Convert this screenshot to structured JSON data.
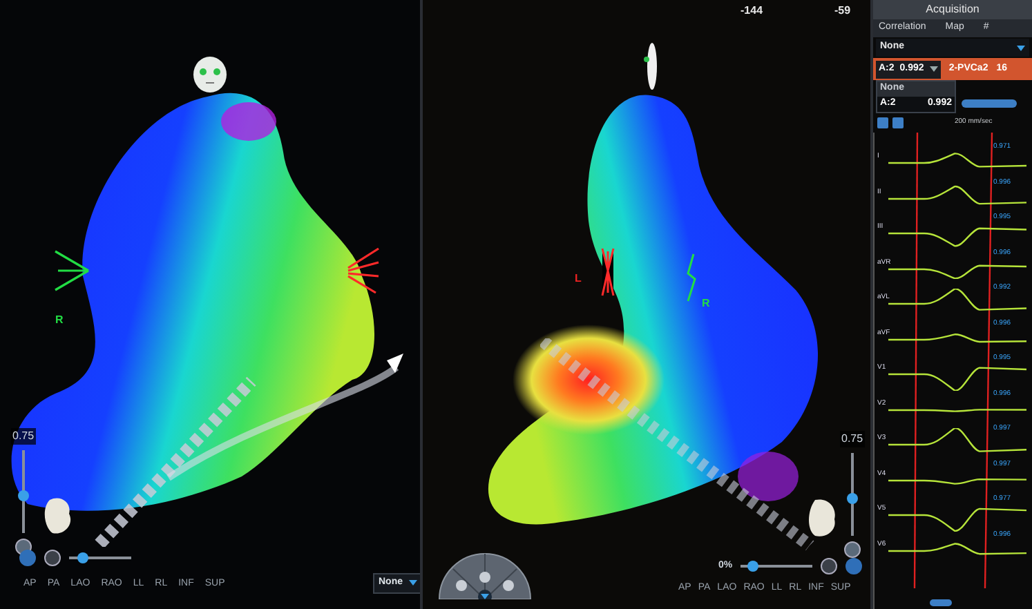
{
  "left_view": {
    "orientation_labels": [
      {
        "text": "R",
        "color": "#22dd44"
      }
    ],
    "zoom": "0.75",
    "zoom_slider": {
      "level": 0.45
    },
    "opacity_slider": {
      "level": 0.15
    },
    "view_buttons": [
      "AP",
      "PA",
      "LAO",
      "RAO",
      "LL",
      "RL",
      "INF",
      "SUP"
    ],
    "dropdown": "None"
  },
  "middle_view": {
    "header_values": [
      "-144",
      "-59"
    ],
    "orientation_labels": [
      {
        "text": "L",
        "color": "#ee2222"
      },
      {
        "text": "R",
        "color": "#22dd44"
      }
    ],
    "zoom": "0.75",
    "zoom_slider": {
      "level": 0.45
    },
    "opacity": "0%",
    "opacity_slider": {
      "level": 0.1
    },
    "view_buttons": [
      "AP",
      "PA",
      "LAO",
      "RAO",
      "LL",
      "RL",
      "INF",
      "SUP"
    ]
  },
  "acquisition": {
    "title": "Acquisition",
    "columns": [
      "Correlation",
      "Map",
      "#"
    ],
    "filter": "None",
    "correlation_dropdown": {
      "label": "A:2",
      "value": "0.992",
      "expanded": true
    },
    "map": "2-PVCa2",
    "count": "16",
    "options": [
      {
        "label": "None",
        "selected": false
      },
      {
        "label": "A:2",
        "value": "0.992",
        "selected": true
      }
    ],
    "speed": "200 mm/sec",
    "leads": [
      {
        "label": "I",
        "correlation": "0.971"
      },
      {
        "label": "II",
        "correlation": "0.996"
      },
      {
        "label": "III",
        "correlation": "0.995"
      },
      {
        "label": "aVR",
        "correlation": "0.996"
      },
      {
        "label": "aVL",
        "correlation": "0.992"
      },
      {
        "label": "aVF",
        "correlation": "0.996"
      },
      {
        "label": "V1",
        "correlation": "0.995"
      },
      {
        "label": "V2",
        "correlation": "0.996"
      },
      {
        "label": "V3",
        "correlation": "0.997"
      },
      {
        "label": "V4",
        "correlation": "0.997"
      },
      {
        "label": "V5",
        "correlation": "0.977"
      },
      {
        "label": "V6",
        "correlation": "0.996"
      }
    ]
  }
}
